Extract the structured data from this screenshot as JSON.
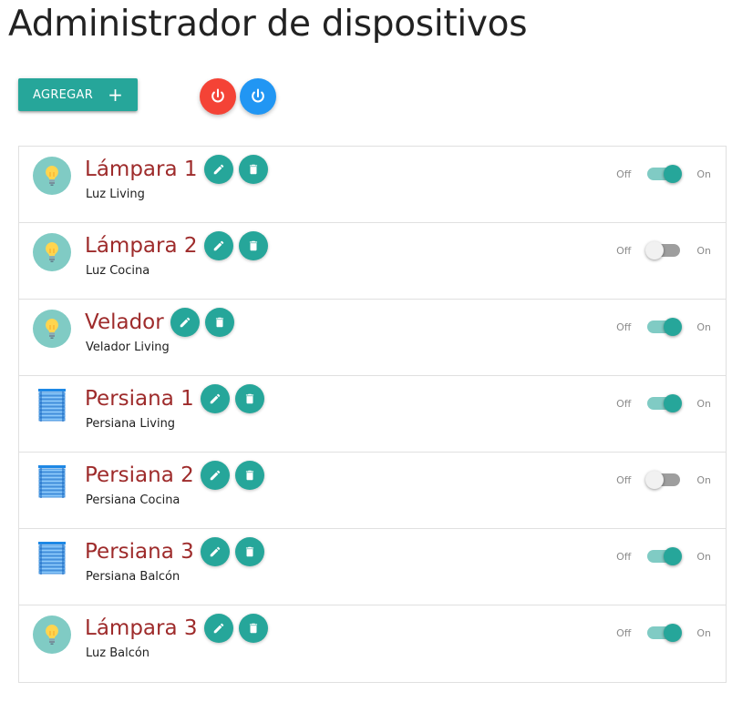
{
  "page": {
    "title": "Administrador de dispositivos"
  },
  "toolbar": {
    "add_label": "AGREGAR",
    "add_icon": "+"
  },
  "colors": {
    "accent": "#26a69a",
    "device_name": "#9e2b2b",
    "power_off": "#f44336",
    "power_on": "#2196f3"
  },
  "switch_labels": {
    "off": "Off",
    "on": "On"
  },
  "devices": [
    {
      "name": "Lámpara 1",
      "description": "Luz Living",
      "icon": "lightbulb-icon",
      "on": true
    },
    {
      "name": "Lámpara 2",
      "description": "Luz Cocina",
      "icon": "lightbulb-icon",
      "on": false
    },
    {
      "name": "Velador",
      "description": "Velador Living",
      "icon": "lightbulb-icon",
      "on": true
    },
    {
      "name": "Persiana 1",
      "description": "Persiana Living",
      "icon": "blind-icon",
      "on": true
    },
    {
      "name": "Persiana 2",
      "description": "Persiana Cocina",
      "icon": "blind-icon",
      "on": false
    },
    {
      "name": "Persiana 3",
      "description": "Persiana Balcón",
      "icon": "blind-icon",
      "on": true
    },
    {
      "name": "Lámpara 3",
      "description": "Luz Balcón",
      "icon": "lightbulb-icon",
      "on": true
    }
  ]
}
